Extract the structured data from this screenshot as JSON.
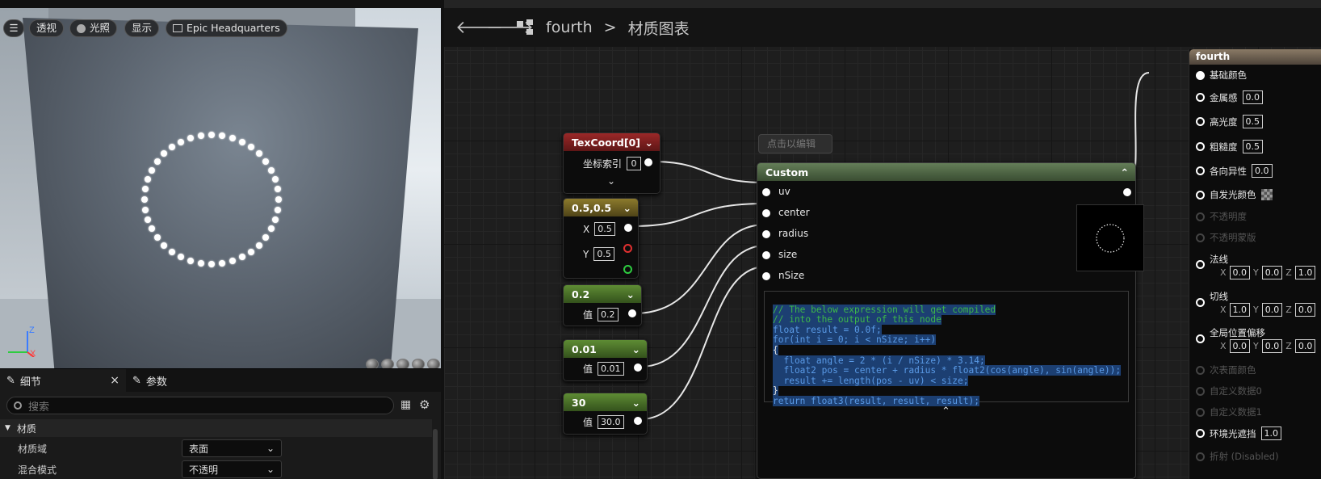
{
  "viewport": {
    "buttons": {
      "perspective": "透视",
      "lighting": "光照",
      "show": "显示",
      "hq": "Epic Headquarters"
    },
    "axis": {
      "z": "Z",
      "x": "X"
    }
  },
  "details": {
    "tab_details": "细节",
    "tab_close": "×",
    "tab_params": "参数",
    "search_placeholder": "搜索",
    "section": "材质",
    "rows": [
      {
        "label": "材质域",
        "value": "表面"
      },
      {
        "label": "混合模式",
        "value": "不透明"
      }
    ]
  },
  "graph_header": {
    "asset": "fourth",
    "separator": ">",
    "page": "材质图表"
  },
  "nodes": {
    "texcoord": {
      "title": "TexCoord[0]",
      "label": "坐标索引",
      "value": "0"
    },
    "vec2": {
      "title": "0.5,0.5",
      "x_label": "X",
      "x": "0.5",
      "y_label": "Y",
      "y": "0.5"
    },
    "radius": {
      "title": "0.2",
      "label": "值",
      "value": "0.2"
    },
    "size": {
      "title": "0.01",
      "label": "值",
      "value": "0.01"
    },
    "nsize": {
      "title": "30",
      "label": "值",
      "value": "30.0"
    },
    "comment_bubble": "点击以编辑",
    "custom": {
      "title": "Custom",
      "inputs": [
        "uv",
        "center",
        "radius",
        "size",
        "nSize"
      ],
      "code": [
        "// The below expression will get compiled",
        "// into the output of this node",
        "float result = 0.0f;",
        "for(int i = 0; i < nSize; i++)",
        "{",
        "  float angle = 2 * (i / nSize) * 3.14;",
        "  float2 pos = center + radius * float2(cos(angle), sin(angle));",
        "  result += length(pos - uv) < size;",
        "}",
        "return float3(result, result, result);"
      ]
    }
  },
  "result": {
    "title": "fourth",
    "base_color": "基础颜色",
    "metallic": "金属感",
    "metallic_v": "0.0",
    "specular": "高光度",
    "specular_v": "0.5",
    "roughness": "粗糙度",
    "roughness_v": "0.5",
    "anisotropy": "各向异性",
    "anisotropy_v": "0.0",
    "emissive": "自发光颜色",
    "opacity": "不透明度",
    "opacity_mask": "不透明蒙版",
    "normal": "法线",
    "normal_x": "0.0",
    "normal_y": "0.0",
    "normal_z": "1.0",
    "tangent": "切线",
    "tangent_x": "1.0",
    "tangent_y": "0.0",
    "tangent_z": "0.0",
    "wpo": "全局位置偏移",
    "wpo_x": "0.0",
    "wpo_y": "0.0",
    "wpo_z": "0.0",
    "subsurface": "次表面颜色",
    "custom0": "自定义数据0",
    "custom1": "自定义数据1",
    "ao": "环境光遮挡",
    "ao_v": "1.0",
    "refraction": "折射 (Disabled)",
    "xyz": {
      "x": "X",
      "y": "Y",
      "z": "Z"
    }
  }
}
